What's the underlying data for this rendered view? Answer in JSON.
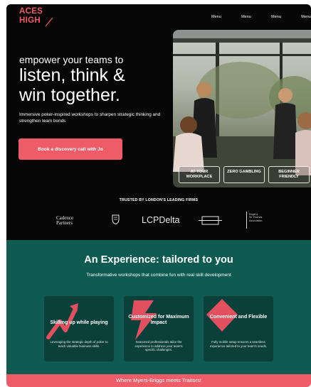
{
  "brand": {
    "logo_line1": "ACES",
    "logo_line2": "HIGH",
    "accent": "#ee5c68",
    "teal": "#0f5b52",
    "dark": "#060606"
  },
  "nav": {
    "items": [
      "Menu",
      "Menu",
      "Menu",
      "Menu"
    ]
  },
  "hero": {
    "kicker": "empower your teams to",
    "headline_line1": "listen, think &",
    "headline_line2": "win together.",
    "subtext": "Immersive poker-inspired workshops to sharpen strategic thinking and strengthen team bonds",
    "cta_label": "Book a discovery call with Jo",
    "tags": [
      "AT YOUR WORKPLACE",
      "ZERO GAMBLING",
      "BEGINNER FRIENDLY"
    ]
  },
  "trusted": {
    "heading": "TRUSTED BY LONDON'S LEADING FIRMS",
    "logos": {
      "cadence_line1": "Cadence",
      "cadence_line2": "Partners",
      "lcp": "LCPDelta",
      "assoc_line1": "Royal &",
      "assoc_line2": "Sir Thomas",
      "assoc_line3": "Association"
    }
  },
  "experience": {
    "title_prefix": "An Experience: ",
    "title_bold": "tailored to you",
    "subtitle": "Transformative workshops that combine fun with real skill development",
    "cards": [
      {
        "title": "Skilling up while playing",
        "desc": "Leveraging the strategic depth of poker to teach valuable business skills.",
        "icon": "arrow-up-icon"
      },
      {
        "title": "Customized for Maximum Impact",
        "desc": "Seasoned professionals tailor the experience to address your team's specific challenges.",
        "icon": "lightning-icon"
      },
      {
        "title": "Convenient and Flexible",
        "desc": "Fully mobile setup ensures a seamless experience tailored to your team's needs.",
        "icon": "diamond-icon"
      }
    ]
  },
  "banner": {
    "text": "Where Myers-Briggs meets Traitors!"
  }
}
